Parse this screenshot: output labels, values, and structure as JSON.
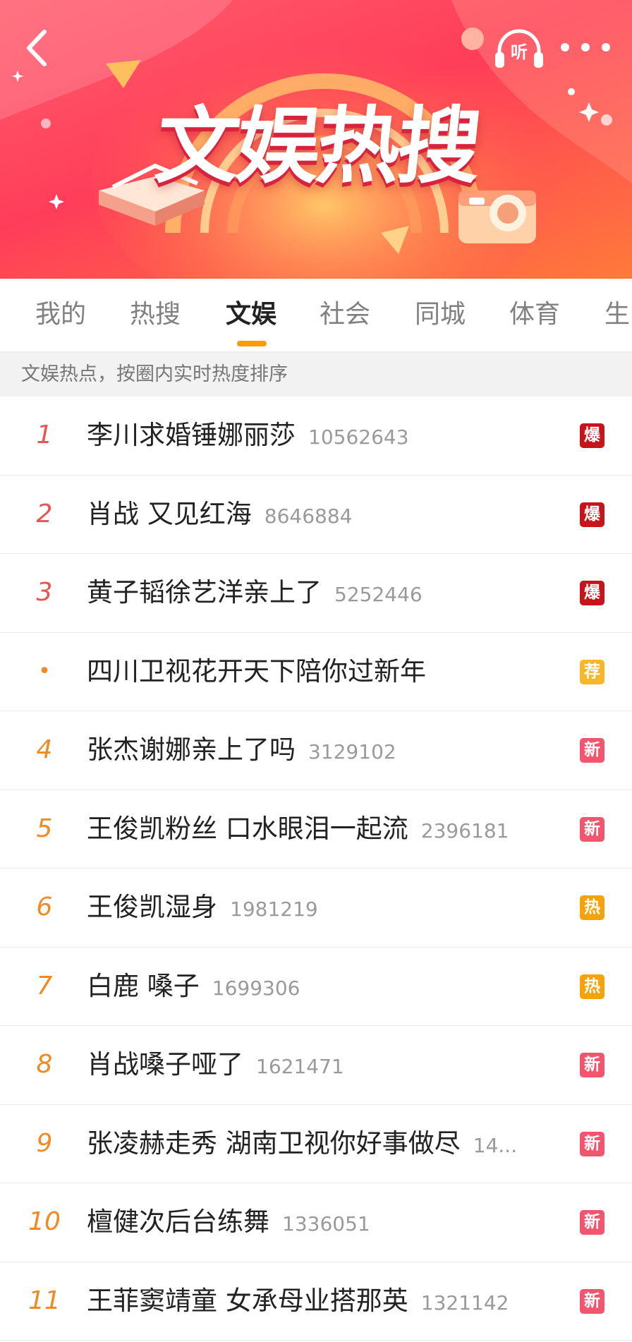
{
  "banner": {
    "title": "文娱热搜",
    "listen_label": "听"
  },
  "colors": {
    "accent": "#ff9a00",
    "badge_bao": "#c6141b",
    "badge_jian": "#f6b72c",
    "badge_xin": "#f2566f",
    "badge_re": "#f6a20c",
    "rank_top": "#e55555",
    "rank_normal": "#f08a24"
  },
  "tabs": [
    {
      "label": "我的",
      "active": false
    },
    {
      "label": "热搜",
      "active": false
    },
    {
      "label": "文娱",
      "active": true
    },
    {
      "label": "社会",
      "active": false
    },
    {
      "label": "同城",
      "active": false
    },
    {
      "label": "体育",
      "active": false
    },
    {
      "label": "生",
      "active": false
    }
  ],
  "subheader": "文娱热点，按圈内实时热度排序",
  "items": [
    {
      "rank": "1",
      "title": "李川求婚锤娜丽莎",
      "count": "10562643",
      "badge": "爆",
      "badge_type": "bao"
    },
    {
      "rank": "2",
      "title": "肖战 又见红海",
      "count": "8646884",
      "badge": "爆",
      "badge_type": "bao"
    },
    {
      "rank": "3",
      "title": "黄子韬徐艺洋亲上了",
      "count": "5252446",
      "badge": "爆",
      "badge_type": "bao"
    },
    {
      "rank": "•",
      "title": "四川卫视花开天下陪你过新年",
      "count": "",
      "badge": "荐",
      "badge_type": "jian"
    },
    {
      "rank": "4",
      "title": "张杰谢娜亲上了吗",
      "count": "3129102",
      "badge": "新",
      "badge_type": "xin"
    },
    {
      "rank": "5",
      "title": "王俊凯粉丝 口水眼泪一起流",
      "count": "2396181",
      "badge": "新",
      "badge_type": "xin"
    },
    {
      "rank": "6",
      "title": "王俊凯湿身",
      "count": "1981219",
      "badge": "热",
      "badge_type": "re"
    },
    {
      "rank": "7",
      "title": "白鹿 嗓子",
      "count": "1699306",
      "badge": "热",
      "badge_type": "re"
    },
    {
      "rank": "8",
      "title": "肖战嗓子哑了",
      "count": "1621471",
      "badge": "新",
      "badge_type": "xin"
    },
    {
      "rank": "9",
      "title": "张凌赫走秀 湖南卫视你好事做尽",
      "count": "14...",
      "badge": "新",
      "badge_type": "xin"
    },
    {
      "rank": "10",
      "title": "檀健次后台练舞",
      "count": "1336051",
      "badge": "新",
      "badge_type": "xin"
    },
    {
      "rank": "11",
      "title": "王菲窦靖童 女承母业搭那英",
      "count": "1321142",
      "badge": "新",
      "badge_type": "xin"
    }
  ]
}
